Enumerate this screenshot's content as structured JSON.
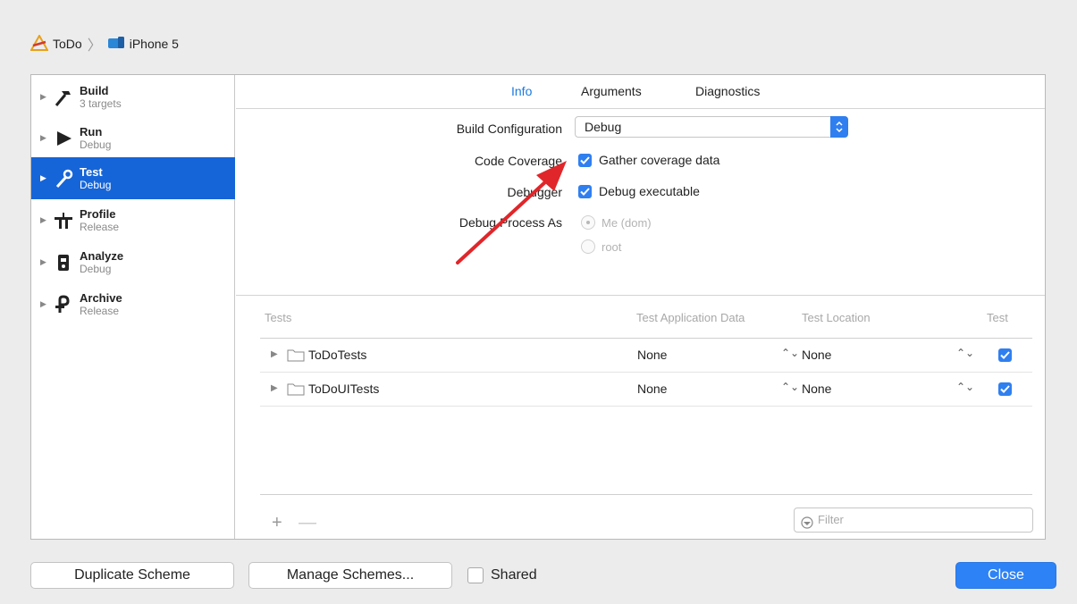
{
  "breadcrumb": {
    "project": "ToDo",
    "device": "iPhone 5"
  },
  "sidebar": {
    "items": [
      {
        "title": "Build",
        "subtitle": "3 targets",
        "icon": "hammer-icon",
        "selected": false
      },
      {
        "title": "Run",
        "subtitle": "Debug",
        "icon": "play-icon",
        "selected": false
      },
      {
        "title": "Test",
        "subtitle": "Debug",
        "icon": "wrench-icon",
        "selected": true
      },
      {
        "title": "Profile",
        "subtitle": "Release",
        "icon": "instruments-icon",
        "selected": false
      },
      {
        "title": "Analyze",
        "subtitle": "Debug",
        "icon": "analyze-icon",
        "selected": false
      },
      {
        "title": "Archive",
        "subtitle": "Release",
        "icon": "archive-icon",
        "selected": false
      }
    ]
  },
  "tabs": {
    "info": "Info",
    "arguments": "Arguments",
    "diagnostics": "Diagnostics",
    "active": "Info"
  },
  "form": {
    "build_config_label": "Build Configuration",
    "build_config_value": "Debug",
    "code_coverage_label": "Code Coverage",
    "gather_coverage_label": "Gather coverage data",
    "gather_coverage_checked": true,
    "debugger_label": "Debugger",
    "debug_executable_label": "Debug executable",
    "debug_executable_checked": true,
    "debug_process_label": "Debug Process As",
    "radio_me": "Me (dom)",
    "radio_root": "root"
  },
  "tests_table": {
    "headers": {
      "tests": "Tests",
      "app_data": "Test Application Data",
      "location": "Test Location",
      "test": "Test"
    },
    "rows": [
      {
        "name": "ToDoTests",
        "app_data": "None",
        "location": "None",
        "enabled": true
      },
      {
        "name": "ToDoUITests",
        "app_data": "None",
        "location": "None",
        "enabled": true
      }
    ],
    "add": "+",
    "remove": "—",
    "filter_placeholder": "Filter"
  },
  "footer": {
    "duplicate": "Duplicate Scheme",
    "manage": "Manage Schemes...",
    "shared": "Shared",
    "close": "Close"
  },
  "colors": {
    "accent": "#2f7ff0",
    "selection": "#1665d8",
    "annotation_arrow": "#e0262a"
  }
}
